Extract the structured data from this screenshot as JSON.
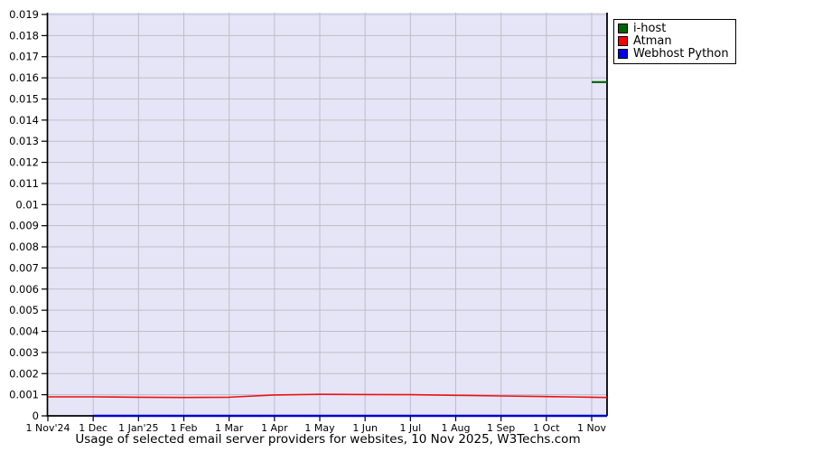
{
  "title": {
    "text": "Usage of selected email server providers for websites, 10 Nov 2025, W3Techs.com"
  },
  "legend": {
    "items": [
      {
        "label": "i-host",
        "color": "#006400"
      },
      {
        "label": "Atman",
        "color": "#ff0000"
      },
      {
        "label": "Webhost Python",
        "color": "#0000ee"
      }
    ]
  },
  "chart_data": {
    "type": "line",
    "title": "Usage of selected email server providers for websites, 10 Nov 2025, W3Techs.com",
    "xlabel": "",
    "ylabel": "",
    "x_unit": "months since 1 Nov 2024",
    "x": [
      0,
      1,
      2,
      3,
      4,
      5,
      6,
      7,
      8,
      9,
      10,
      11,
      12,
      12.34
    ],
    "x_tick_labels": [
      "1 Nov'24",
      "1 Dec",
      "1 Jan'25",
      "1 Feb",
      "1 Mar",
      "1 Apr",
      "1 May",
      "1 Jun",
      "1 Jul",
      "1 Aug",
      "1 Sep",
      "1 Oct",
      "1 Nov"
    ],
    "y_tick_labels": [
      "0",
      "0.001",
      "0.002",
      "0.003",
      "0.004",
      "0.005",
      "0.006",
      "0.007",
      "0.008",
      "0.009",
      "0.01",
      "0.011",
      "0.012",
      "0.013",
      "0.014",
      "0.015",
      "0.016",
      "0.017",
      "0.018",
      "0.019"
    ],
    "ylim": [
      0,
      0.019
    ],
    "grid": true,
    "legend_position": "top-right-outside",
    "plot_bg": "#e5e5f7",
    "grid_color": "#bdbdc8",
    "axis_color": "#000000",
    "series": [
      {
        "name": "i-host",
        "color": "#006400",
        "values": [
          null,
          null,
          null,
          null,
          null,
          null,
          null,
          null,
          null,
          null,
          null,
          null,
          0.0158,
          0.0158
        ]
      },
      {
        "name": "Atman",
        "color": "#ee1111",
        "values": [
          0.0009,
          0.0009,
          0.00088,
          0.00087,
          0.00088,
          0.00099,
          0.00102,
          0.00101,
          0.001,
          0.00097,
          0.00094,
          0.00091,
          0.00088,
          0.00087
        ]
      },
      {
        "name": "Webhost Python",
        "color": "#0000cc",
        "values": [
          null,
          0,
          0,
          0,
          0,
          0,
          0,
          0,
          0,
          0,
          0,
          0,
          0,
          0
        ]
      }
    ]
  }
}
